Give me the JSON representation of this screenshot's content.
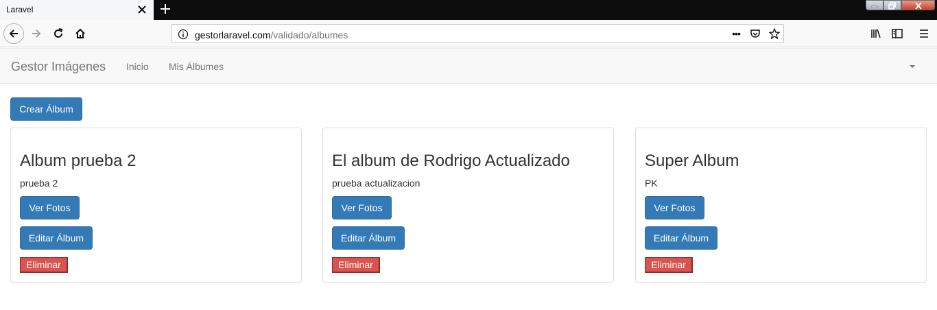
{
  "browser": {
    "tab_title": "Laravel",
    "url_domain": "gestorlaravel.com",
    "url_path": "/validado/albumes",
    "url_actions_more": "•••"
  },
  "app": {
    "brand": "Gestor Imágenes",
    "nav": [
      "Inicio",
      "Mis Álbumes"
    ],
    "create_label": "Crear Álbum"
  },
  "albums": [
    {
      "title": "Album prueba 2",
      "desc": "prueba 2",
      "view_label": "Ver Fotos",
      "edit_label": "Editar Álbum",
      "delete_label": "Eliminar"
    },
    {
      "title": "El album de Rodrigo Actualizado",
      "desc": "prueba actualizacion",
      "view_label": "Ver Fotos",
      "edit_label": "Editar Álbum",
      "delete_label": "Eliminar"
    },
    {
      "title": "Super Album",
      "desc": "PK",
      "view_label": "Ver Fotos",
      "edit_label": "Editar Álbum",
      "delete_label": "Eliminar"
    }
  ],
  "colors": {
    "primary": "#337ab7",
    "danger": "#d9534f",
    "navbar_bg": "#f8f8f8"
  }
}
